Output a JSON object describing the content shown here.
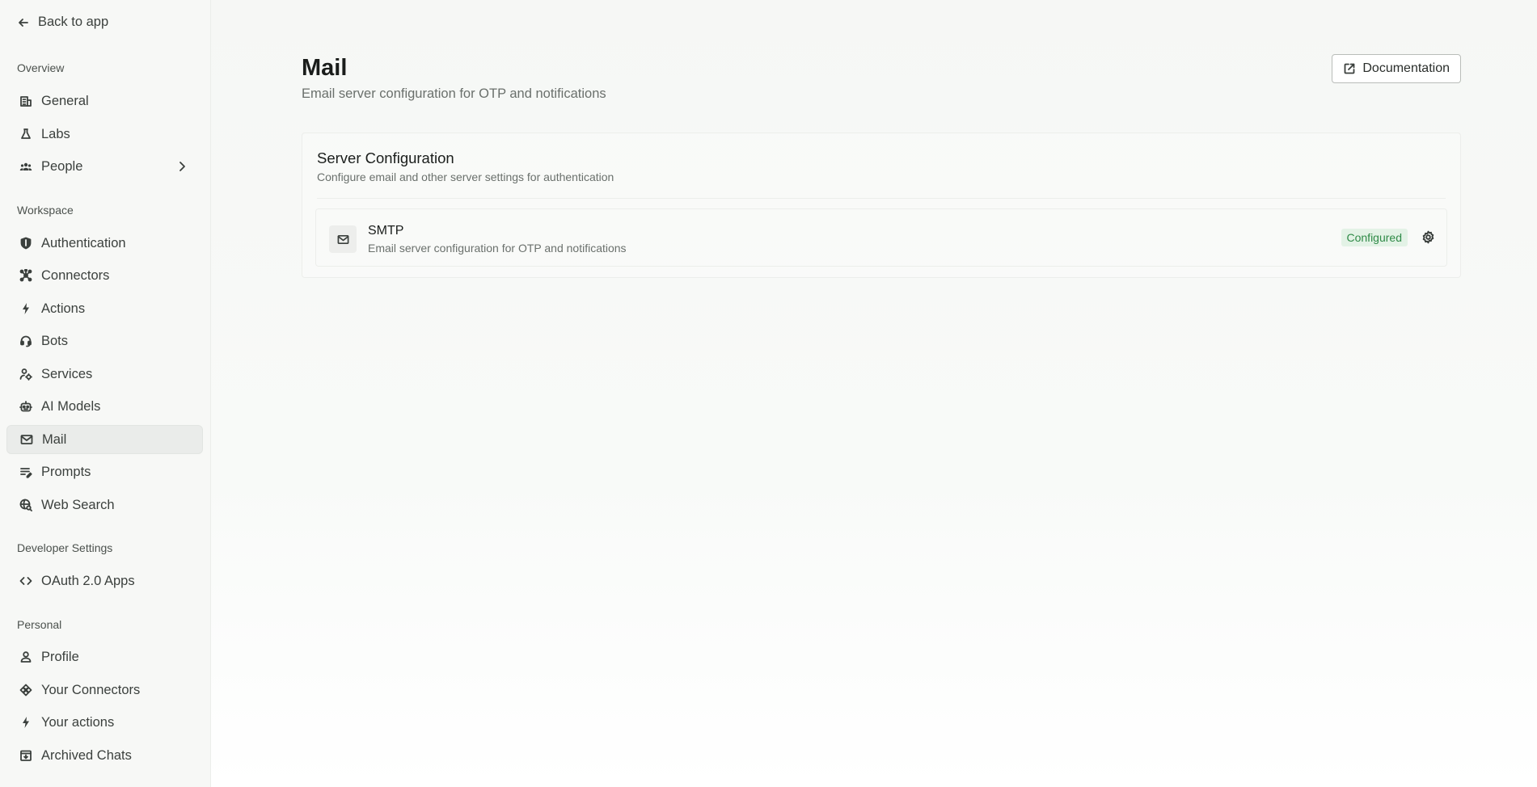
{
  "sidebar": {
    "back_label": "Back to app",
    "sections": [
      {
        "label": "Overview",
        "items": [
          {
            "label": "General",
            "icon": "building-icon"
          },
          {
            "label": "Labs",
            "icon": "flask-icon"
          },
          {
            "label": "People",
            "icon": "people-icon",
            "has_submenu": true
          }
        ]
      },
      {
        "label": "Workspace",
        "items": [
          {
            "label": "Authentication",
            "icon": "shield-icon"
          },
          {
            "label": "Connectors",
            "icon": "hub-icon"
          },
          {
            "label": "Actions",
            "icon": "bolt-icon"
          },
          {
            "label": "Bots",
            "icon": "headset-icon"
          },
          {
            "label": "Services",
            "icon": "services-icon"
          },
          {
            "label": "AI Models",
            "icon": "robot-icon"
          },
          {
            "label": "Mail",
            "icon": "mail-icon",
            "active": true
          },
          {
            "label": "Prompts",
            "icon": "prompt-icon"
          },
          {
            "label": "Web Search",
            "icon": "web-search-icon"
          }
        ]
      },
      {
        "label": "Developer Settings",
        "items": [
          {
            "label": "OAuth 2.0 Apps",
            "icon": "code-icon"
          }
        ]
      },
      {
        "label": "Personal",
        "items": [
          {
            "label": "Profile",
            "icon": "user-icon"
          },
          {
            "label": "Your Connectors",
            "icon": "diamond-icon"
          },
          {
            "label": "Your actions",
            "icon": "bolt-icon"
          },
          {
            "label": "Archived Chats",
            "icon": "archive-icon"
          }
        ]
      }
    ]
  },
  "header": {
    "title": "Mail",
    "subtitle": "Email server configuration for OTP and notifications",
    "doc_button": "Documentation"
  },
  "server_config": {
    "title": "Server Configuration",
    "description": "Configure email and other server settings for authentication",
    "items": [
      {
        "name": "SMTP",
        "description": "Email server configuration for OTP and notifications",
        "status": "Configured",
        "status_color": "#2f8a47"
      }
    ]
  }
}
